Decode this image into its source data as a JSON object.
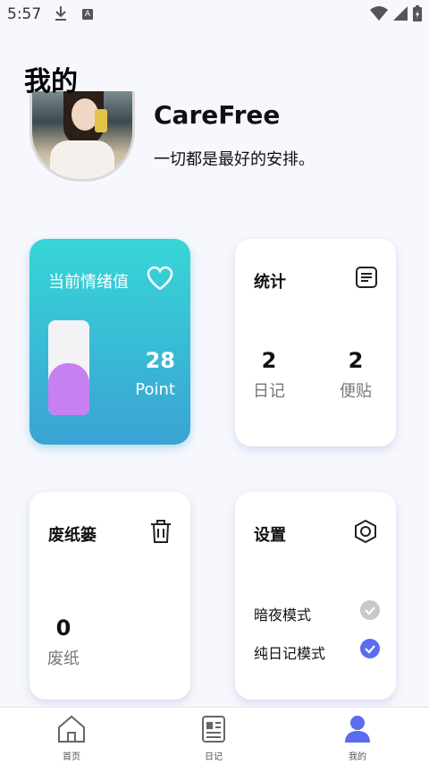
{
  "status_bar": {
    "time": "5:57",
    "a_badge": "A"
  },
  "header": {
    "title": "我的"
  },
  "profile": {
    "name": "CareFree",
    "motto": "一切都是最好的安排。"
  },
  "mood_card": {
    "label": "当前情绪值",
    "value": "28",
    "unit": "Point",
    "level": 0.55,
    "gradient_top": "#37d6d6",
    "gradient_bottom": "#3aa3d4",
    "fill_color": "#c77ff2"
  },
  "stats_card": {
    "title": "统计",
    "items": [
      {
        "count": "2",
        "label": "日记"
      },
      {
        "count": "2",
        "label": "便贴"
      }
    ]
  },
  "trash_card": {
    "title": "废纸篓",
    "count": "0",
    "label": "废纸"
  },
  "settings_card": {
    "title": "设置",
    "options": [
      {
        "label": "暗夜模式",
        "checked": false,
        "color": "#c8c8cc"
      },
      {
        "label": "纯日记模式",
        "checked": true,
        "color": "#5b6cf0"
      }
    ]
  },
  "bottom_nav": {
    "items": [
      {
        "label": "首页"
      },
      {
        "label": "日记"
      },
      {
        "label": "我的"
      }
    ],
    "active_color": "#5b6cf0"
  }
}
